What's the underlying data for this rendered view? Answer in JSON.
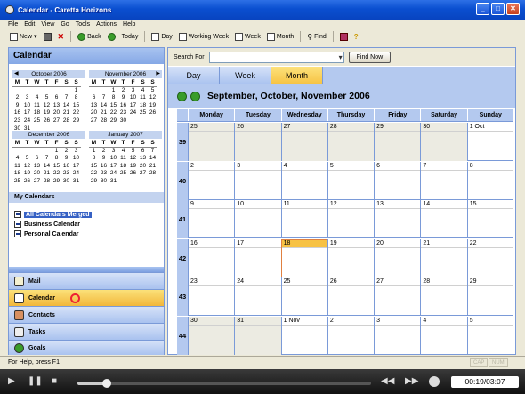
{
  "window": {
    "title": "Calendar - Caretta Horizons",
    "min": "_",
    "max": "□",
    "close": "✕"
  },
  "menu": [
    "File",
    "Edit",
    "View",
    "Go",
    "Tools",
    "Actions",
    "Help"
  ],
  "toolbar": {
    "new": "New",
    "back": "Back",
    "today": "Today",
    "day": "Day",
    "working_week": "Working Week",
    "week": "Week",
    "month": "Month",
    "find": "Find"
  },
  "left": {
    "header": "Calendar",
    "mini_calendars": [
      {
        "month": "October 2006",
        "days": [
          "",
          "",
          "",
          "",
          "",
          "",
          "1",
          "2",
          "3",
          "4",
          "5",
          "6",
          "7",
          "8",
          "9",
          "10",
          "11",
          "12",
          "13",
          "14",
          "15",
          "16",
          "17",
          "18",
          "19",
          "20",
          "21",
          "22",
          "23",
          "24",
          "25",
          "26",
          "27",
          "28",
          "29",
          "30",
          "31"
        ]
      },
      {
        "month": "November 2006",
        "days": [
          "",
          "",
          "1",
          "2",
          "3",
          "4",
          "5",
          "6",
          "7",
          "8",
          "9",
          "10",
          "11",
          "12",
          "13",
          "14",
          "15",
          "16",
          "17",
          "18",
          "19",
          "20",
          "21",
          "22",
          "23",
          "24",
          "25",
          "26",
          "27",
          "28",
          "29",
          "30"
        ]
      },
      {
        "month": "December 2006",
        "days": [
          "",
          "",
          "",
          "",
          "1",
          "2",
          "3",
          "4",
          "5",
          "6",
          "7",
          "8",
          "9",
          "10",
          "11",
          "12",
          "13",
          "14",
          "15",
          "16",
          "17",
          "18",
          "19",
          "20",
          "21",
          "22",
          "23",
          "24",
          "25",
          "26",
          "27",
          "28",
          "29",
          "30",
          "31"
        ]
      },
      {
        "month": "January 2007",
        "days": [
          "1",
          "2",
          "3",
          "4",
          "5",
          "6",
          "7",
          "8",
          "9",
          "10",
          "11",
          "12",
          "13",
          "14",
          "15",
          "16",
          "17",
          "18",
          "19",
          "20",
          "21",
          "22",
          "23",
          "24",
          "25",
          "26",
          "27",
          "28",
          "29",
          "30",
          "31"
        ]
      }
    ],
    "weekday_letters": [
      "M",
      "T",
      "W",
      "T",
      "F",
      "S",
      "S"
    ],
    "my_calendars_title": "My Calendars",
    "my_calendars": [
      "All Calendars Merged",
      "Business Calendar",
      "Personal Calendar"
    ],
    "nav": [
      "Mail",
      "Calendar",
      "Contacts",
      "Tasks",
      "Goals"
    ]
  },
  "search": {
    "label": "Search For",
    "button": "Find Now",
    "value": ""
  },
  "tabs": [
    "Day",
    "Week",
    "Month"
  ],
  "range_title": "September, October, November 2006",
  "weekdays": [
    "Monday",
    "Tuesday",
    "Wednesday",
    "Thursday",
    "Friday",
    "Saturday",
    "Sunday"
  ],
  "weeks": [
    {
      "num": "39",
      "days": [
        "25",
        "26",
        "27",
        "28",
        "29",
        "30",
        "1 Oct"
      ]
    },
    {
      "num": "40",
      "days": [
        "2",
        "3",
        "4",
        "5",
        "6",
        "7",
        "8"
      ]
    },
    {
      "num": "41",
      "days": [
        "9",
        "10",
        "11",
        "12",
        "13",
        "14",
        "15"
      ]
    },
    {
      "num": "42",
      "days": [
        "16",
        "17",
        "18",
        "19",
        "20",
        "21",
        "22"
      ]
    },
    {
      "num": "43",
      "days": [
        "23",
        "24",
        "25",
        "26",
        "27",
        "28",
        "29"
      ]
    },
    {
      "num": "44",
      "days": [
        "30",
        "31",
        "1 Nov",
        "2",
        "3",
        "4",
        "5"
      ]
    }
  ],
  "status": {
    "text": "For Help, press F1",
    "cap": "CAP",
    "num": "NUM"
  },
  "player": {
    "timecode": "00:19/03:07",
    "progress": 0.1
  }
}
